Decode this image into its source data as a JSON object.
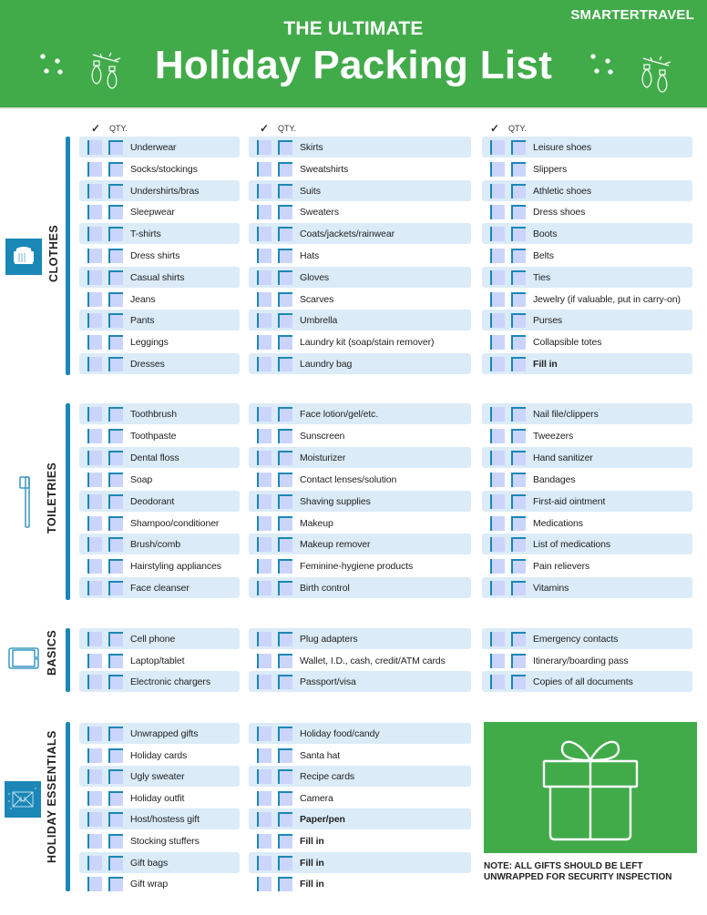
{
  "header": {
    "brand": "SMARTERTRAVEL",
    "subtitle": "THE ULTIMATE",
    "title": "Holiday Packing List",
    "background_color": "#41ab4a",
    "decorations": [
      "snowflakes-icon",
      "string-lights-icon"
    ]
  },
  "column_header": {
    "check_symbol": "✓",
    "qty_label": "QTY."
  },
  "accent_color": "#1b87b6",
  "row_shade_color": "#dbebf8",
  "checkbox_fill_color": "#cbd5fb",
  "sections": [
    {
      "name": "CLOTHES",
      "icon": "sweater-icon",
      "columns": [
        [
          "Underwear",
          "Socks/stockings",
          "Undershirts/bras",
          "Sleepwear",
          "T-shirts",
          "Dress shirts",
          "Casual shirts",
          "Jeans",
          "Pants",
          "Leggings",
          "Dresses"
        ],
        [
          "Skirts",
          "Sweatshirts",
          "Suits",
          "Sweaters",
          "Coats/jackets/rainwear",
          "Hats",
          "Gloves",
          "Scarves",
          "Umbrella",
          "Laundry kit (soap/stain remover)",
          "Laundry bag"
        ],
        [
          "Leisure shoes",
          "Slippers",
          "Athletic shoes",
          "Dress shoes",
          "Boots",
          "Belts",
          "Ties",
          "Jewelry (if valuable, put in carry-on)",
          "Purses",
          "Collapsible totes",
          "Fill in"
        ]
      ]
    },
    {
      "name": "TOILETRIES",
      "icon": "toothbrush-icon",
      "columns": [
        [
          "Toothbrush",
          "Toothpaste",
          "Dental floss",
          "Soap",
          "Deodorant",
          "Shampoo/conditioner",
          "Brush/comb",
          "Hairstyling appliances",
          "Face cleanser"
        ],
        [
          "Face lotion/gel/etc.",
          "Sunscreen",
          "Moisturizer",
          "Contact lenses/solution",
          "Shaving supplies",
          "Makeup",
          "Makeup remover",
          "Feminine-hygiene products",
          "Birth control"
        ],
        [
          "Nail file/clippers",
          "Tweezers",
          "Hand sanitizer",
          "Bandages",
          "First-aid ointment",
          "Medications",
          "List of medications",
          "Pain relievers",
          "Vitamins"
        ]
      ]
    },
    {
      "name": "BASICS",
      "icon": "phone-icon",
      "columns": [
        [
          "Cell phone",
          "Laptop/tablet",
          "Electronic chargers"
        ],
        [
          "Plug adapters",
          "Wallet, I.D., cash, credit/ATM cards",
          "Passport/visa"
        ],
        [
          "Emergency contacts",
          "Itinerary/boarding pass",
          "Copies of all documents"
        ]
      ]
    },
    {
      "name": "HOLIDAY ESSENTIALS",
      "icon": "gift-envelope-icon",
      "columns": [
        [
          "Unwrapped gifts",
          "Holiday cards",
          "Ugly sweater",
          "Holiday outfit",
          "Host/hostess gift",
          "Stocking stuffers",
          "Gift bags",
          "Gift wrap"
        ],
        [
          "Holiday food/candy",
          "Santa hat",
          "Recipe cards",
          "Camera",
          "Paper/pen",
          "Fill in",
          "Fill in",
          "Fill in"
        ]
      ]
    }
  ],
  "gift_panel": {
    "icon": "gift-box-icon",
    "note": "NOTE: ALL GIFTS SHOULD BE LEFT UNWRAPPED FOR SECURITY INSPECTION"
  }
}
